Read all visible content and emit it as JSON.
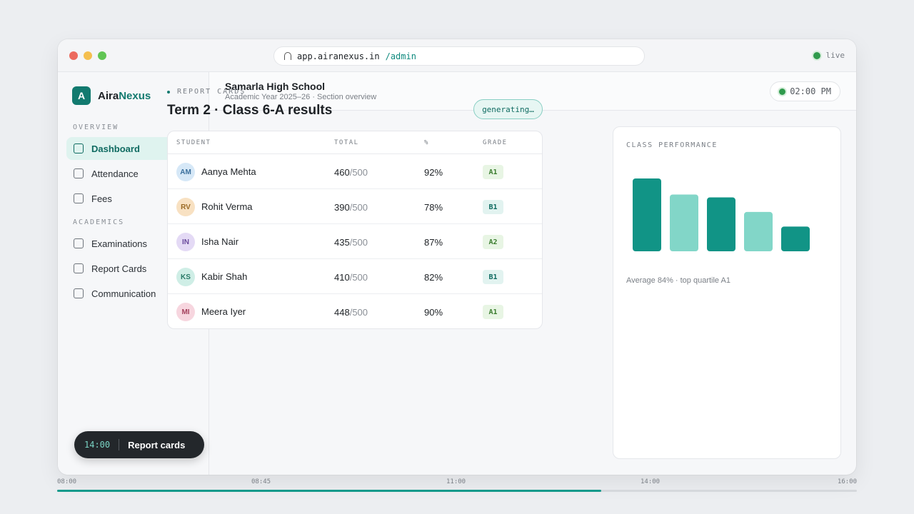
{
  "browser": {
    "url_host": "app.airanexus.in",
    "url_path": "/admin",
    "status": "live"
  },
  "brand": {
    "name_prefix": "Aira",
    "name_accent": "Nexus",
    "mark": "A"
  },
  "sidebar": {
    "sections": [
      {
        "label": "OVERVIEW",
        "items": [
          {
            "label": "Dashboard",
            "active": true
          },
          {
            "label": "Attendance",
            "active": false
          },
          {
            "label": "Fees",
            "active": false
          }
        ]
      },
      {
        "label": "ACADEMICS",
        "items": [
          {
            "label": "Examinations",
            "active": false
          },
          {
            "label": "Report Cards",
            "active": false
          },
          {
            "label": "Communication",
            "active": false
          }
        ]
      }
    ]
  },
  "header": {
    "school": "Samarla High School",
    "subtitle": "Academic Year 2025–26 · Section overview",
    "time": "02:00 PM"
  },
  "report": {
    "eyebrow": "REPORT CARDS",
    "title": "Term 2 · Class 6-A results",
    "status": "generating…",
    "columns": [
      "STUDENT",
      "TOTAL",
      "%",
      "GRADE"
    ],
    "rows": [
      {
        "initials": "AM",
        "name": "Aanya Mehta",
        "total": "460",
        "max": "/500",
        "percent": "92%",
        "grade": "A1"
      },
      {
        "initials": "RV",
        "name": "Rohit Verma",
        "total": "390",
        "max": "/500",
        "percent": "78%",
        "grade": "B1"
      },
      {
        "initials": "IN",
        "name": "Isha Nair",
        "total": "435",
        "max": "/500",
        "percent": "87%",
        "grade": "A2"
      },
      {
        "initials": "KS",
        "name": "Kabir Shah",
        "total": "410",
        "max": "/500",
        "percent": "82%",
        "grade": "B1"
      },
      {
        "initials": "MI",
        "name": "Meera Iyer",
        "total": "448",
        "max": "/500",
        "percent": "90%",
        "grade": "A1"
      }
    ]
  },
  "performance": {
    "label": "CLASS PERFORMANCE",
    "note": "Average 84% · top quartile A1"
  },
  "chart_data": {
    "type": "bar",
    "title": "CLASS PERFORMANCE",
    "values": [
      100,
      78,
      74,
      54,
      34
    ],
    "colors": [
      "#119486",
      "#82d6c8",
      "#119486",
      "#82d6c8",
      "#119486"
    ],
    "ylim": [
      0,
      100
    ],
    "grid": false,
    "legend": "none"
  },
  "toast": {
    "time": "14:00",
    "text": "Report cards"
  },
  "timeline": {
    "labels": [
      "08:00",
      "08:45",
      "11:00",
      "14:00",
      "16:00"
    ],
    "progress": 0.68
  },
  "colors": {
    "accent": "#127a6f",
    "accent_light": "#82d6c8",
    "live": "#2f9a4c"
  }
}
